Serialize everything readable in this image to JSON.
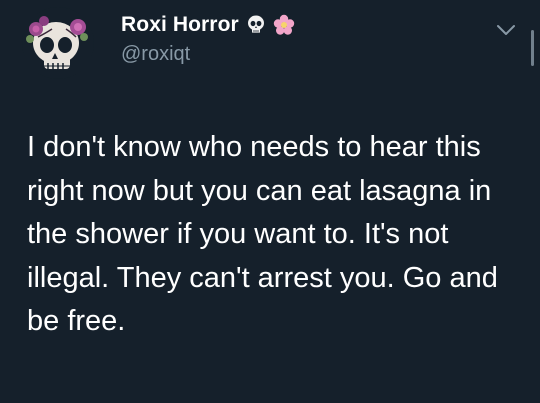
{
  "user": {
    "display_name": "Roxi Horror",
    "handle": "@roxiqt",
    "avatar_icon": "skull-with-flowers-icon",
    "badge_icons": [
      "skull-icon",
      "flower-icon"
    ]
  },
  "tweet": {
    "text": "I don't know who needs to hear this right now but you can eat lasagna in the shower if you want to. It's not illegal. They can't arrest you. Go and be free."
  },
  "actions": {
    "more_icon": "chevron-down-icon"
  },
  "colors": {
    "background": "#15202b",
    "secondary_text": "#8899a6",
    "primary_text": "#ffffff",
    "flower_pink": "#f2a5c9"
  }
}
